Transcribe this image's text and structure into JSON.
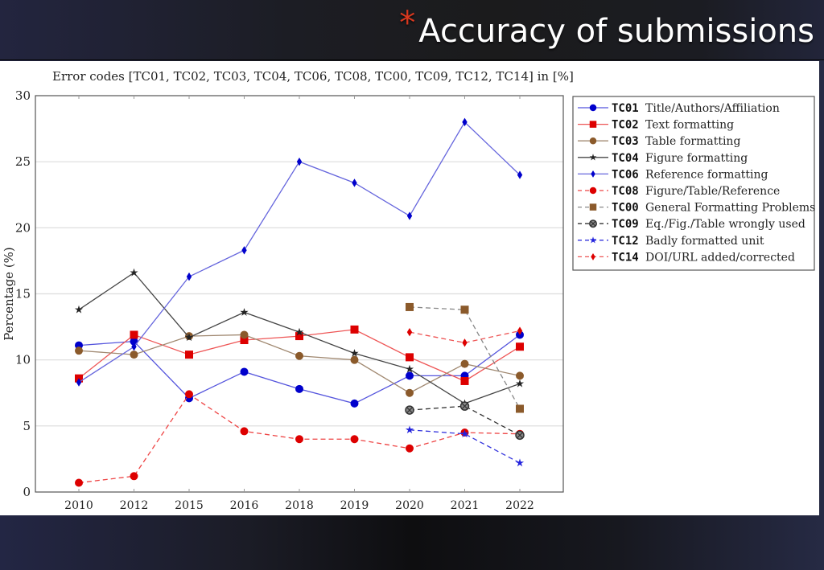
{
  "slide": {
    "bullet": "*",
    "title": "Accuracy of submissions",
    "accent_color": "#d9381e"
  },
  "chart_data": {
    "type": "line",
    "title": "Error codes [TC01, TC02, TC03, TC04, TC06, TC08, TC00, TC09, TC12, TC14] in [%]",
    "xlabel": "",
    "ylabel": "Percentage (%)",
    "categories": [
      "2010",
      "2012",
      "2015",
      "2016",
      "2018",
      "2019",
      "2020",
      "2021",
      "2022"
    ],
    "ylim": [
      0,
      30
    ],
    "yticks": [
      0,
      5,
      10,
      15,
      20,
      25,
      30
    ],
    "grid": "horizontal",
    "legend_position": "right",
    "series": [
      {
        "code": "TC01",
        "name": "Title/Authors/Affiliation",
        "color": "#0000cc",
        "line": "#5555dd",
        "dash": false,
        "marker": "circle",
        "values": [
          11.1,
          11.4,
          7.1,
          9.1,
          7.8,
          6.7,
          8.8,
          8.8,
          11.9
        ]
      },
      {
        "code": "TC02",
        "name": "Text formatting",
        "color": "#dd0000",
        "line": "#ee5555",
        "dash": false,
        "marker": "square",
        "values": [
          8.6,
          11.9,
          10.4,
          11.5,
          11.8,
          12.3,
          10.2,
          8.4,
          11.0
        ]
      },
      {
        "code": "TC03",
        "name": "Table formatting",
        "color": "#8b5a2b",
        "line": "#a08870",
        "dash": false,
        "marker": "circle",
        "values": [
          10.7,
          10.4,
          11.8,
          11.9,
          10.3,
          10.0,
          7.5,
          9.7,
          8.8
        ]
      },
      {
        "code": "TC04",
        "name": "Figure formatting",
        "color": "#222222",
        "line": "#444444",
        "dash": false,
        "marker": "star",
        "values": [
          13.8,
          16.6,
          11.7,
          13.6,
          12.1,
          10.5,
          9.3,
          6.7,
          8.2
        ]
      },
      {
        "code": "TC06",
        "name": "Reference formatting",
        "color": "#0000cc",
        "line": "#6666dd",
        "dash": false,
        "marker": "diamond",
        "values": [
          8.3,
          11.0,
          16.3,
          18.3,
          25.0,
          23.4,
          20.9,
          28.0,
          24.0
        ]
      },
      {
        "code": "TC08",
        "name": "Figure/Table/Reference",
        "color": "#dd0000",
        "line": "#ee4444",
        "dash": true,
        "marker": "circle",
        "values": [
          0.7,
          1.2,
          7.4,
          4.6,
          4.0,
          4.0,
          3.3,
          4.5,
          4.4
        ]
      },
      {
        "code": "TC00",
        "name": "General Formatting Problems",
        "color": "#8b5a2b",
        "line": "#888888",
        "dash": true,
        "marker": "square",
        "values": [
          null,
          null,
          null,
          null,
          null,
          null,
          14.0,
          13.8,
          6.3
        ]
      },
      {
        "code": "TC09",
        "name": "Eq./Fig./Table wrongly used",
        "color": "#333333",
        "line": "#333333",
        "dash": true,
        "marker": "otimes",
        "values": [
          null,
          null,
          null,
          null,
          null,
          null,
          6.2,
          6.5,
          4.3
        ]
      },
      {
        "code": "TC12",
        "name": "Badly formatted unit",
        "color": "#2222dd",
        "line": "#3333dd",
        "dash": true,
        "marker": "star",
        "values": [
          null,
          null,
          null,
          null,
          null,
          null,
          4.7,
          4.4,
          2.2
        ]
      },
      {
        "code": "TC14",
        "name": "DOI/URL added/corrected",
        "color": "#dd0000",
        "line": "#ee5555",
        "dash": true,
        "marker": "diamond",
        "values": [
          null,
          null,
          null,
          null,
          null,
          null,
          12.1,
          11.3,
          12.2
        ]
      }
    ]
  }
}
